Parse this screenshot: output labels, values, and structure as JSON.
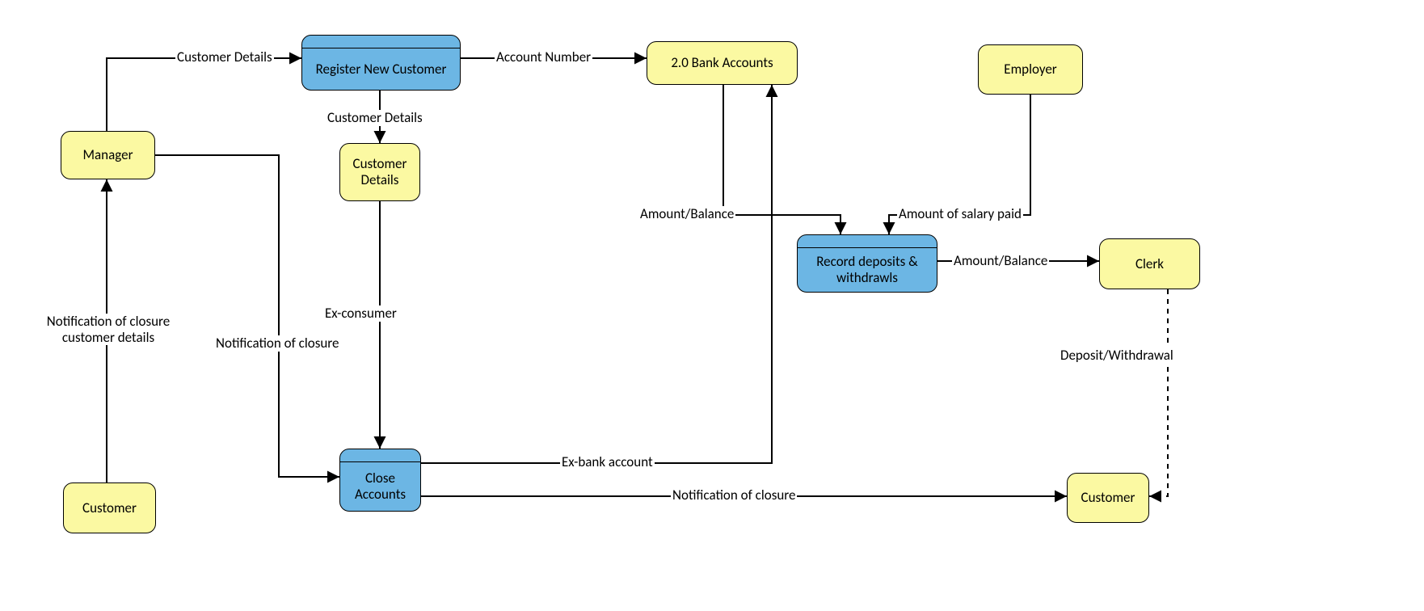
{
  "nodes": {
    "customer_left": {
      "label": "Customer"
    },
    "manager": {
      "label": "Manager"
    },
    "register_customer": {
      "label": "Register New Customer"
    },
    "customer_details": {
      "label": "Customer\nDetails"
    },
    "close_accounts": {
      "label": "Close\nAccounts"
    },
    "bank_accounts": {
      "label": "2.0 Bank Accounts"
    },
    "record_deposits": {
      "label": "Record deposits &\nwithdrawls"
    },
    "employer": {
      "label": "Employer"
    },
    "clerk": {
      "label": "Clerk"
    },
    "customer_right": {
      "label": "Customer"
    }
  },
  "edges": {
    "cust_to_mgr": {
      "label": "Notification of closure\ncustomer details"
    },
    "mgr_to_register": {
      "label": "Customer Details"
    },
    "register_to_bank": {
      "label": "Account Number"
    },
    "register_to_details": {
      "label": "Customer Details"
    },
    "details_to_close": {
      "label": "Ex-consumer"
    },
    "mgr_to_close": {
      "label": "Notification of closure"
    },
    "close_to_bank": {
      "label": "Ex-bank account"
    },
    "close_to_customer": {
      "label": "Notification of closure"
    },
    "bank_to_record": {
      "label": "Amount/Balance"
    },
    "employer_to_record": {
      "label": "Amount of salary paid"
    },
    "record_to_clerk": {
      "label": "Amount/Balance"
    },
    "clerk_to_customer": {
      "label": "Deposit/Withdrawal"
    }
  }
}
